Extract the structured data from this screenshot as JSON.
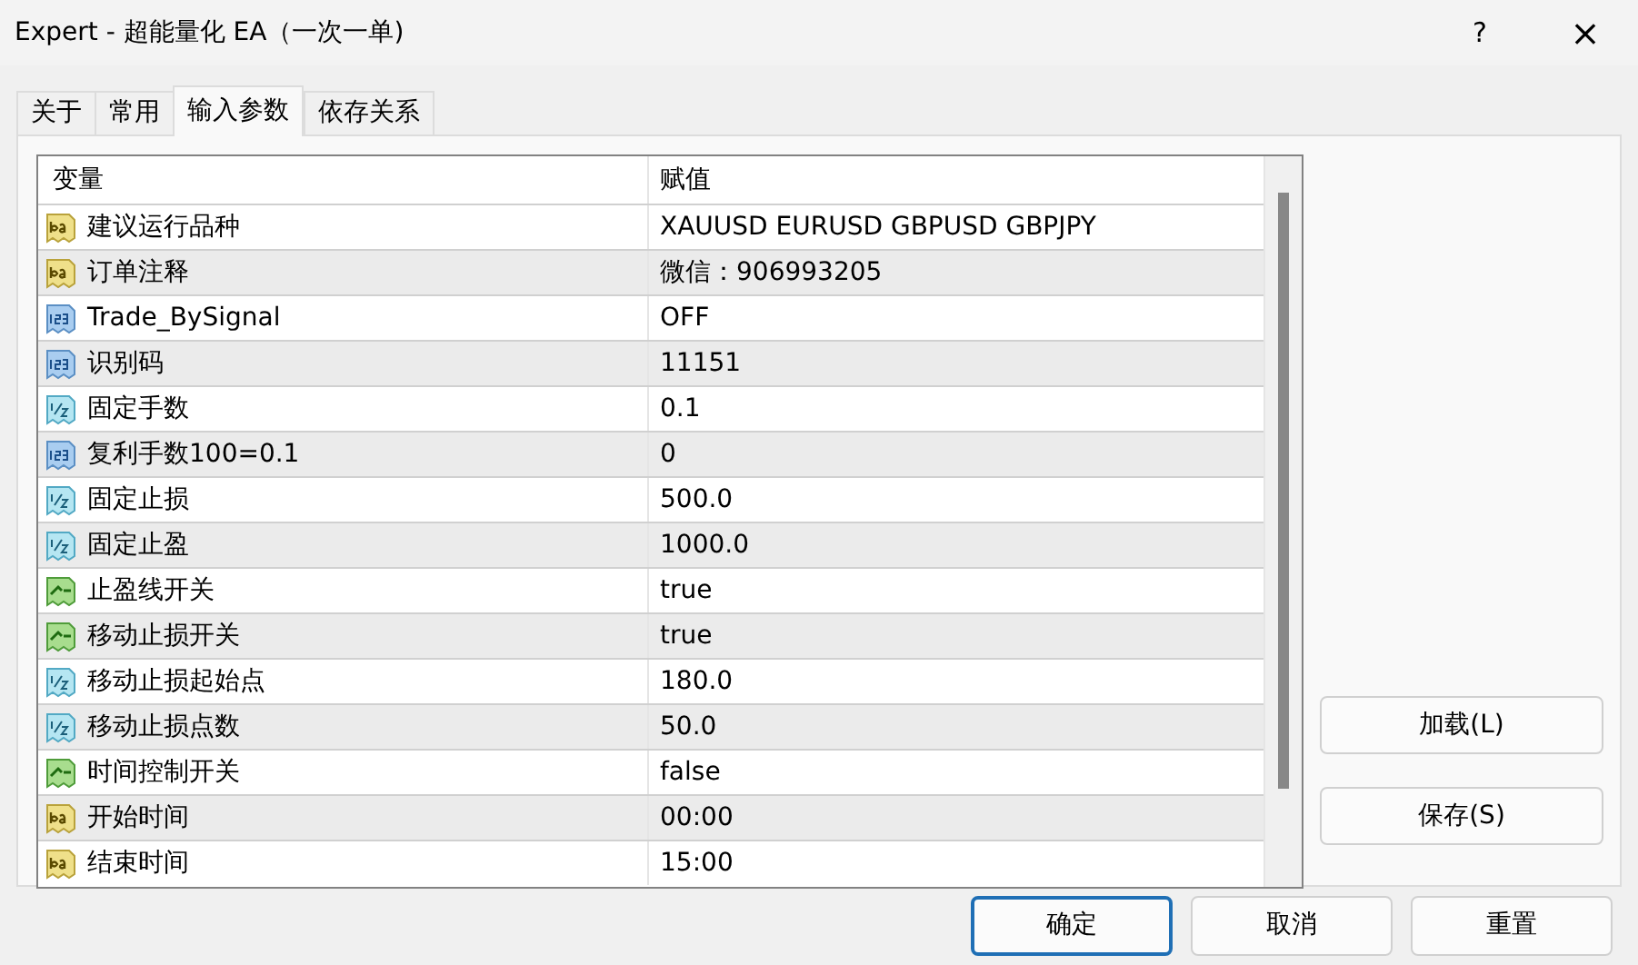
{
  "window": {
    "title": "Expert - 超能量化 EA（一次一单)",
    "help": "?",
    "close": "×"
  },
  "tabs": [
    {
      "label": "关于",
      "selected": false
    },
    {
      "label": "常用",
      "selected": false
    },
    {
      "label": "输入参数",
      "selected": true
    },
    {
      "label": "依存关系",
      "selected": false
    }
  ],
  "table": {
    "columns": [
      "变量",
      "赋值"
    ],
    "rows": [
      {
        "kind": "string",
        "name": "建议运行品种",
        "value": "XAUUSD EURUSD GBPUSD GBPJPY"
      },
      {
        "kind": "string",
        "name": "订单注释",
        "value": "微信：906993205"
      },
      {
        "kind": "int",
        "name": "Trade_BySignal",
        "value": "OFF"
      },
      {
        "kind": "int",
        "name": "识别码",
        "value": "11151"
      },
      {
        "kind": "double",
        "name": "固定手数",
        "value": "0.1"
      },
      {
        "kind": "int",
        "name": "复利手数100=0.1",
        "value": "0"
      },
      {
        "kind": "double",
        "name": "固定止损",
        "value": "500.0"
      },
      {
        "kind": "double",
        "name": "固定止盈",
        "value": "1000.0"
      },
      {
        "kind": "bool",
        "name": "止盈线开关",
        "value": "true"
      },
      {
        "kind": "bool",
        "name": "移动止损开关",
        "value": "true"
      },
      {
        "kind": "double",
        "name": "移动止损起始点",
        "value": "180.0"
      },
      {
        "kind": "double",
        "name": "移动止损点数",
        "value": "50.0"
      },
      {
        "kind": "bool",
        "name": "时间控制开关",
        "value": "false"
      },
      {
        "kind": "string",
        "name": "开始时间",
        "value": "00:00"
      },
      {
        "kind": "string",
        "name": "结束时间",
        "value": "15:00"
      }
    ]
  },
  "side_buttons": [
    "加载(L)",
    "保存(S)"
  ],
  "buttons": [
    {
      "label": "确定",
      "selected": true
    },
    {
      "label": "取消",
      "selected": false
    },
    {
      "label": "重置",
      "selected": false
    }
  ]
}
